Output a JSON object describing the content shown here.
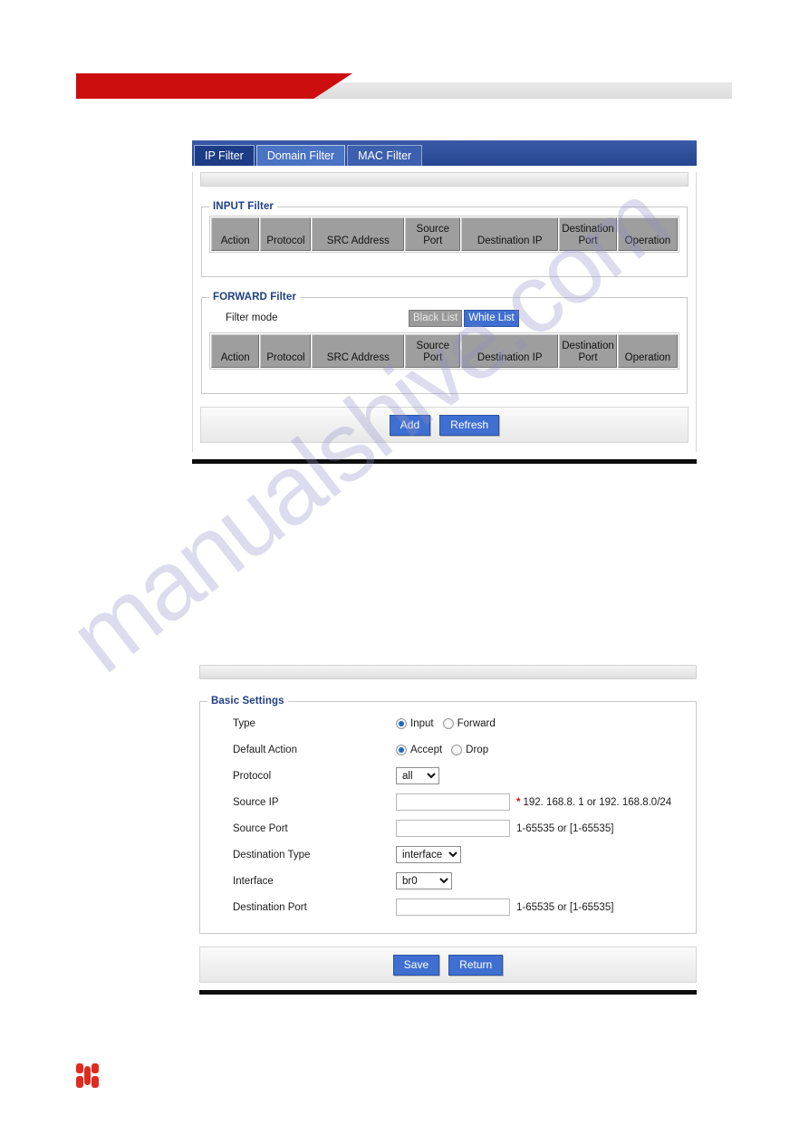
{
  "document": {
    "watermark_text": "manualshive.com",
    "header_accent_color": "#cc0d0d",
    "logo_color": "#e02b20"
  },
  "screen_one": {
    "tabs": [
      {
        "label": "IP Filter",
        "state": "active"
      },
      {
        "label": "Domain Filter",
        "state": "hover"
      },
      {
        "label": "MAC Filter",
        "state": "plain"
      }
    ],
    "input_filter": {
      "legend": "INPUT Filter",
      "columns": [
        "Action",
        "Protocol",
        "SRC Address",
        "Source Port",
        "Destination IP",
        "Destination Port",
        "Operation"
      ],
      "rows": []
    },
    "forward_filter": {
      "legend": "FORWARD Filter",
      "filter_mode_label": "Filter mode",
      "modes": [
        {
          "label": "Black List",
          "selected": false
        },
        {
          "label": "White List",
          "selected": true
        }
      ],
      "columns": [
        "Action",
        "Protocol",
        "SRC Address",
        "Source Port",
        "Destination IP",
        "Destination Port",
        "Operation"
      ],
      "rows": []
    },
    "actions": {
      "add_label": "Add",
      "refresh_label": "Refresh"
    }
  },
  "screen_two": {
    "basic_settings": {
      "legend": "Basic Settings",
      "fields": {
        "type": {
          "label": "Type",
          "options": [
            {
              "label": "Input",
              "selected": true
            },
            {
              "label": "Forward",
              "selected": false
            }
          ]
        },
        "default_action": {
          "label": "Default Action",
          "options": [
            {
              "label": "Accept",
              "selected": true
            },
            {
              "label": "Drop",
              "selected": false
            }
          ]
        },
        "protocol": {
          "label": "Protocol",
          "value": "all"
        },
        "source_ip": {
          "label": "Source IP",
          "value": "",
          "required_marker": "*",
          "hint": "192. 168.8. 1 or 192. 168.8.0/24"
        },
        "source_port": {
          "label": "Source Port",
          "value": "",
          "hint": "1-65535 or [1-65535]"
        },
        "destination_type": {
          "label": "Destination Type",
          "value": "interface"
        },
        "interface": {
          "label": "Interface",
          "value": "br0"
        },
        "destination_port": {
          "label": "Destination Port",
          "value": "",
          "hint": "1-65535 or [1-65535]"
        }
      }
    },
    "actions": {
      "save_label": "Save",
      "return_label": "Return"
    }
  }
}
